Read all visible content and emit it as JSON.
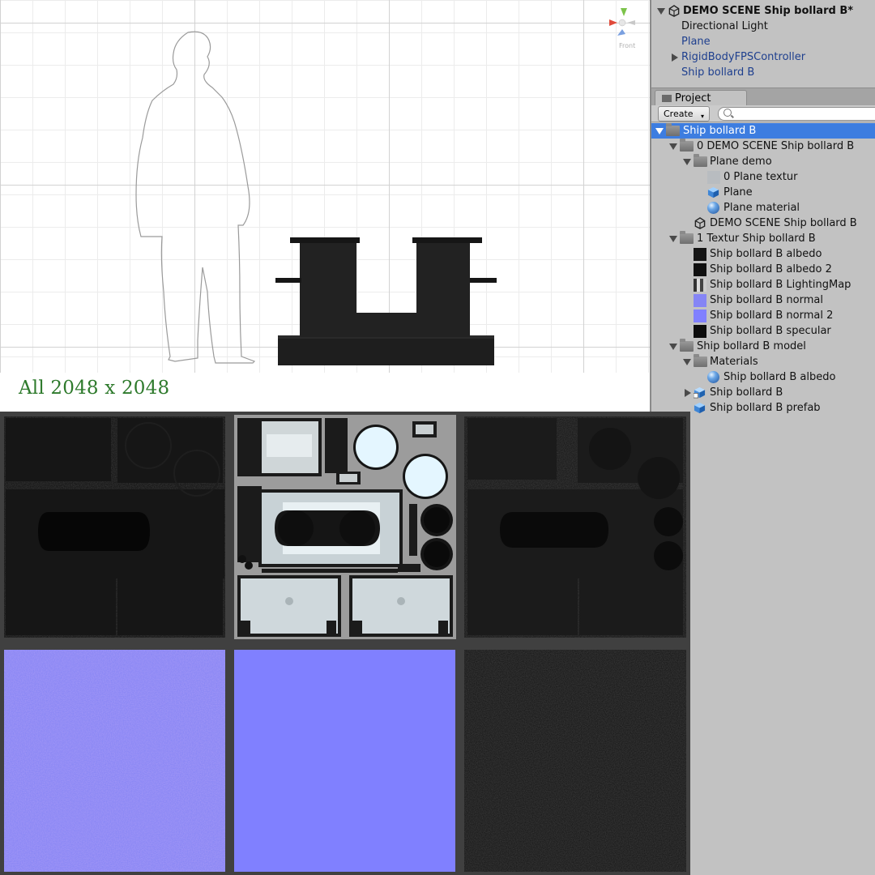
{
  "scene": {
    "caption": "All 2048 x 2048",
    "gizmo_label": "Front"
  },
  "hierarchy": {
    "items": [
      {
        "label": "DEMO SCENE Ship bollard B*",
        "icon": "unity-scene-icon",
        "expanded": true
      },
      {
        "label": "Directional Light"
      },
      {
        "label": "Plane"
      },
      {
        "label": "RigidBodyFPSController",
        "expanded": false
      },
      {
        "label": "Ship bollard B"
      }
    ]
  },
  "project": {
    "tab_label": "Project",
    "create_label": "Create",
    "search_value": "",
    "items": [
      {
        "label": "Ship bollard B",
        "icon": "folder-icon",
        "selected": true
      },
      {
        "label": "0 DEMO SCENE Ship bollard B",
        "icon": "folder-icon"
      },
      {
        "label": "Plane demo",
        "icon": "folder-icon"
      },
      {
        "label": "0 Plane textur",
        "icon": "texture-thumbnail-icon"
      },
      {
        "label": "Plane",
        "icon": "cube-icon"
      },
      {
        "label": "Plane material",
        "icon": "material-sphere-icon"
      },
      {
        "label": "DEMO SCENE Ship bollard B",
        "icon": "unity-scene-icon"
      },
      {
        "label": "1 Textur Ship bollard B",
        "icon": "folder-icon"
      },
      {
        "label": "Ship bollard B albedo",
        "icon": "texture-thumbnail-icon"
      },
      {
        "label": "Ship bollard B albedo 2",
        "icon": "texture-thumbnail-icon"
      },
      {
        "label": "Ship bollard B LightingMap",
        "icon": "texture-thumbnail-icon"
      },
      {
        "label": "Ship bollard B normal",
        "icon": "texture-thumbnail-icon"
      },
      {
        "label": "Ship bollard B normal 2",
        "icon": "texture-thumbnail-icon"
      },
      {
        "label": "Ship bollard B specular",
        "icon": "texture-thumbnail-icon"
      },
      {
        "label": "Ship bollard B  model",
        "icon": "folder-icon"
      },
      {
        "label": "Materials",
        "icon": "folder-icon"
      },
      {
        "label": "Ship bollard B albedo",
        "icon": "material-sphere-icon"
      },
      {
        "label": "Ship bollard B",
        "icon": "model-prefab-icon"
      },
      {
        "label": "Ship bollard B prefab",
        "icon": "prefab-cube-icon"
      }
    ]
  },
  "colors": {
    "selection": "#3d7de0",
    "caption_green": "#2e7a2c",
    "normal_map": "#8080ff",
    "hierarchy_blue": "#1e3f8e"
  }
}
